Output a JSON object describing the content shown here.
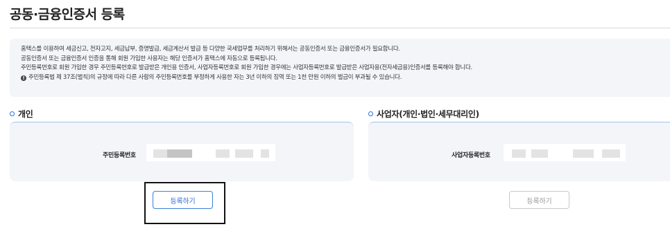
{
  "page": {
    "title": "공동·금융인증서 등록"
  },
  "notice": {
    "lines": [
      "홈택스를 이용하여 세금신고, 전자고지, 세금납부, 증명발급, 세금계산서 발급 등 다양한 국세업무를 처리하기 위해서는 공동인증서 또는 금융인증서가 필요합니다.",
      "공동인증서 또는 금융인증서 인증을 통해 회원 가입한 사용자는 해당 인증서가 홈택스에 자동으로 등록됩니다.",
      "주민등록번호로 회원 가입한 경우 주민등록번호로 발급받은 개인용 인증서, 사업자등록번호로 회원 가입한 경우에는 사업자등록번호로 발급받은 사업자용(전자세금용)인증서를 등록해야 합니다."
    ],
    "warning_icon": "!",
    "warning": "주민등록법 제 37조(벌칙)의 규정에 따라 다른 사람의 주민등록번호를 부정하게 사용한 자는 3년 이하의 징역 또는 1천 만원 이하의 벌금이 부과될 수 있습니다."
  },
  "individual": {
    "title": "개인",
    "field_label": "주민등록번호",
    "button": "등록하기"
  },
  "business": {
    "title": "사업자(개인·법인·세무대리인)",
    "field_label": "사업자등록번호",
    "button": "등록하기"
  },
  "colors": {
    "accent": "#2b6fd6",
    "panel_bg": "#f3f5f8",
    "disabled_text": "#9a9a9a"
  }
}
